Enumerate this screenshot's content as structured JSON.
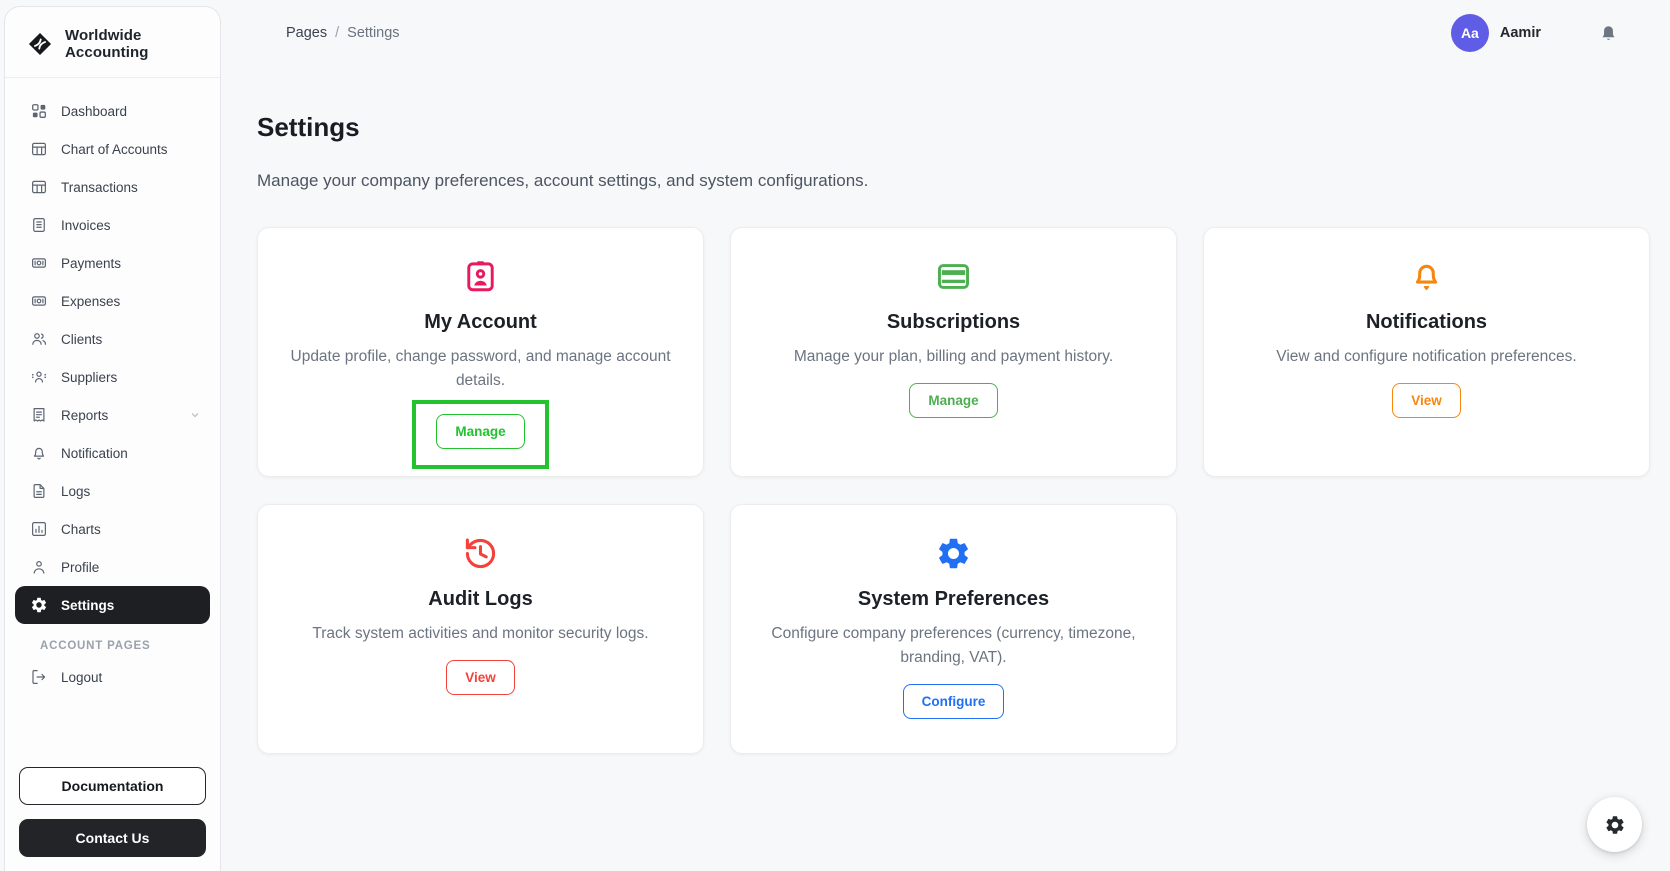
{
  "app": {
    "brand": "Worldwide Accounting"
  },
  "sidebar": {
    "items": [
      {
        "label": "Dashboard",
        "icon": "dashboard-icon"
      },
      {
        "label": "Chart of Accounts",
        "icon": "table-icon"
      },
      {
        "label": "Transactions",
        "icon": "table-icon"
      },
      {
        "label": "Invoices",
        "icon": "invoice-icon"
      },
      {
        "label": "Payments",
        "icon": "banknote-icon"
      },
      {
        "label": "Expenses",
        "icon": "banknote-icon"
      },
      {
        "label": "Clients",
        "icon": "clients-icon"
      },
      {
        "label": "Suppliers",
        "icon": "suppliers-icon"
      },
      {
        "label": "Reports",
        "icon": "report-icon",
        "has_chevron": true
      },
      {
        "label": "Notification",
        "icon": "bell-icon"
      },
      {
        "label": "Logs",
        "icon": "file-icon"
      },
      {
        "label": "Charts",
        "icon": "chart-icon"
      },
      {
        "label": "Profile",
        "icon": "person-icon"
      },
      {
        "label": "Settings",
        "icon": "gear-icon",
        "active": true
      }
    ],
    "section_label": "ACCOUNT PAGES",
    "logout_label": "Logout",
    "documentation_button": "Documentation",
    "contact_button": "Contact Us"
  },
  "header": {
    "breadcrumb": {
      "root": "Pages",
      "separator": "/",
      "current": "Settings"
    },
    "user": {
      "initials": "Aa",
      "name": "Aamir",
      "color": "#5f5ce6"
    }
  },
  "page": {
    "title": "Settings",
    "subtitle": "Manage your company preferences, account settings, and system configurations."
  },
  "cards": [
    {
      "title": "My Account",
      "description": "Update profile, change password, and manage account details.",
      "button": "Manage",
      "accent": "#e8195f",
      "icon": "id-badge-icon",
      "highlighted": true
    },
    {
      "title": "Subscriptions",
      "description": "Manage your plan, billing and payment history.",
      "button": "Manage",
      "accent": "#4caf50",
      "icon": "credit-card-icon"
    },
    {
      "title": "Notifications",
      "description": "View and configure notification preferences.",
      "button": "View",
      "accent": "#f6860f",
      "icon": "bell-icon"
    },
    {
      "title": "Audit Logs",
      "description": "Track system activities and monitor security logs.",
      "button": "View",
      "accent": "#f4423a",
      "icon": "history-icon"
    },
    {
      "title": "System Preferences",
      "description": "Configure company preferences (currency, timezone, branding, VAT).",
      "button": "Configure",
      "accent": "#2170f4",
      "icon": "gear-icon"
    }
  ],
  "annotation": {
    "color": "#22c32e",
    "target": "my-account-manage-button"
  },
  "colors": {
    "active_item_bg": "#1e1f22",
    "sidebar_bg": "#fdfdfe",
    "page_bg": "#f7f8f9"
  }
}
